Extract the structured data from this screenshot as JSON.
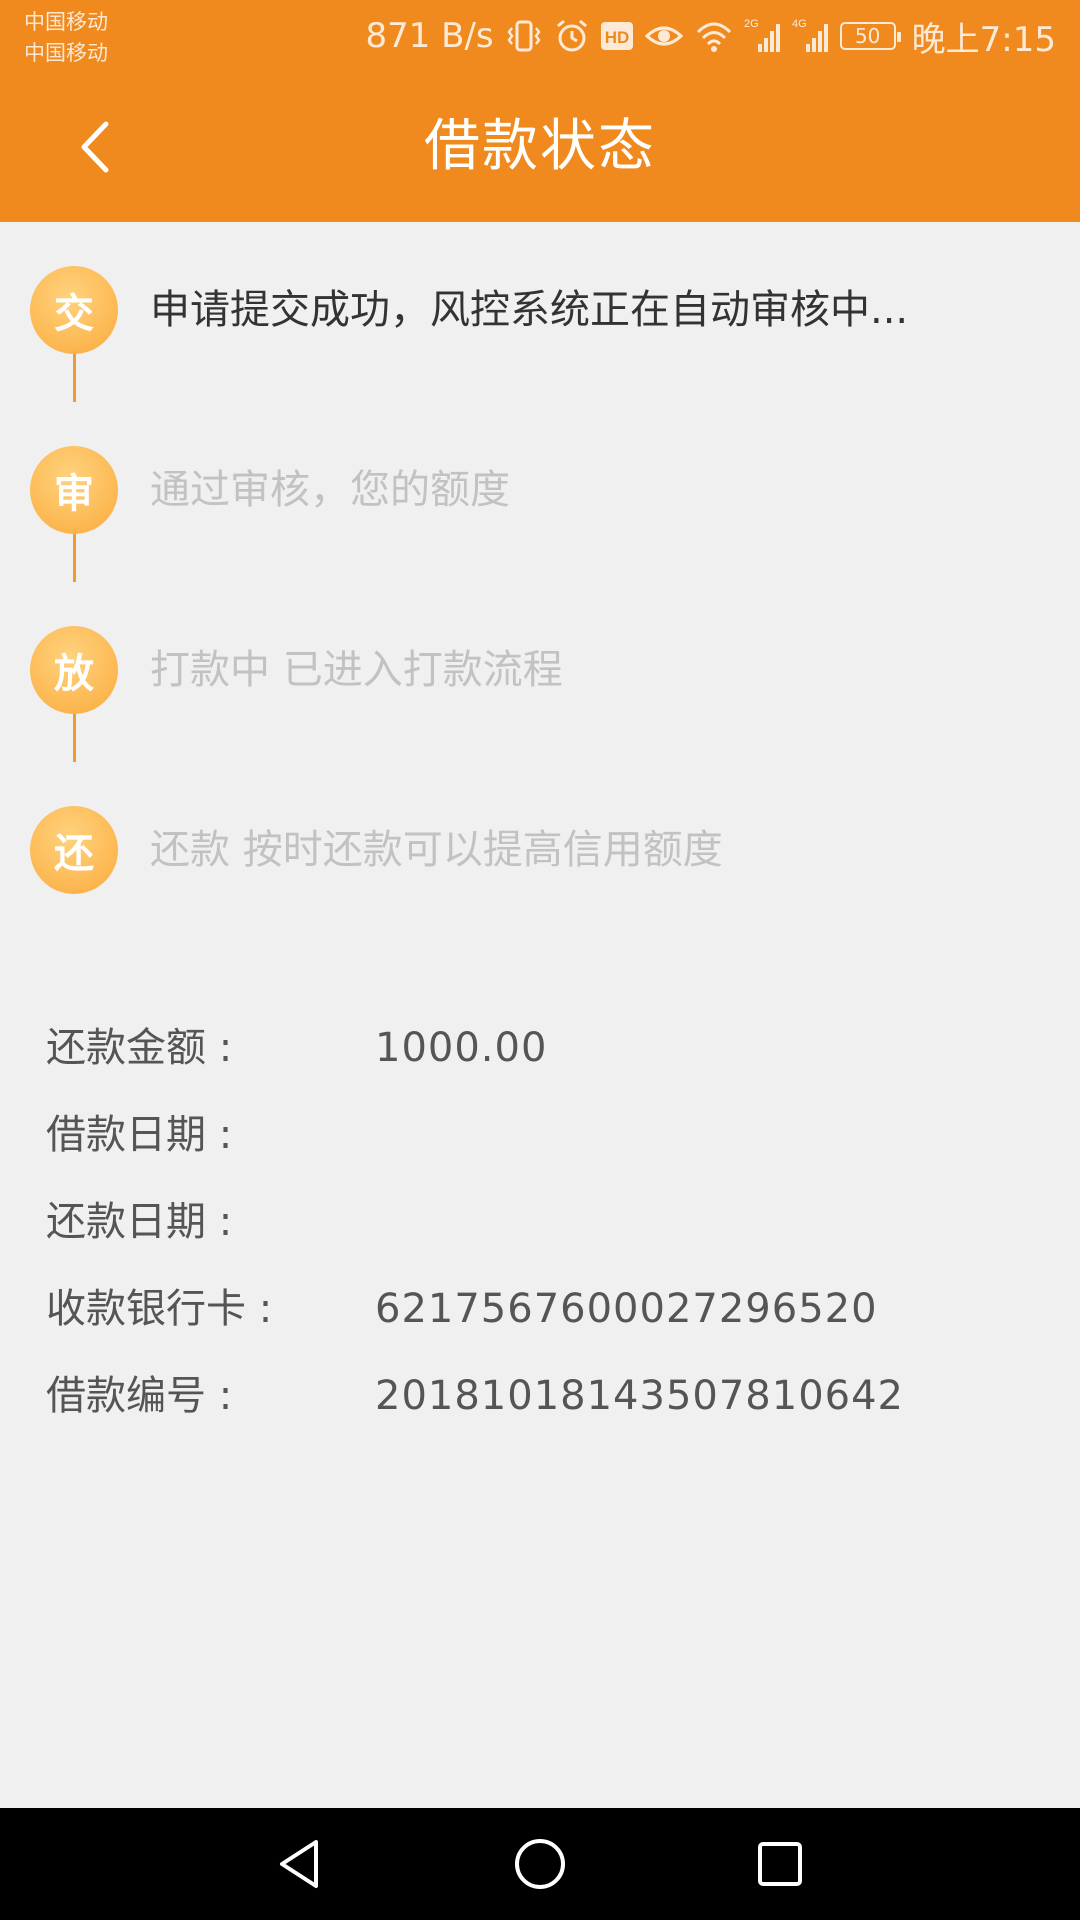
{
  "status_bar": {
    "carrier_1": "中国移动",
    "carrier_2": "中国移动",
    "net_speed": "871 B/s",
    "hd_badge": "HD",
    "battery_level": "50",
    "time": "晚上7:15",
    "signal_1_label": "2G",
    "signal_2_label": "4G",
    "icons": [
      "vibrate-icon",
      "alarm-icon",
      "hd-icon",
      "eye-icon",
      "wifi-icon",
      "signal-2g-icon",
      "signal-4g-icon",
      "battery-icon"
    ]
  },
  "header": {
    "title": "借款状态",
    "back_icon": "chevron-left-icon"
  },
  "timeline": {
    "steps": [
      {
        "badge": "交",
        "text": "申请提交成功，风控系统正在自动审核中...",
        "active": true
      },
      {
        "badge": "审",
        "text": "通过审核，您的额度",
        "active": false
      },
      {
        "badge": "放",
        "text": "打款中 已进入打款流程",
        "active": false
      },
      {
        "badge": "还",
        "text": "还款 按时还款可以提高信用额度",
        "active": false
      }
    ]
  },
  "details": {
    "rows": [
      {
        "label": "还款金额 :",
        "value": "1000.00"
      },
      {
        "label": "借款日期 :",
        "value": ""
      },
      {
        "label": "还款日期 :",
        "value": ""
      },
      {
        "label": "收款银行卡 :",
        "value": "6217567600027296520"
      },
      {
        "label": "借款编号 :",
        "value": "20181018143507810642"
      }
    ]
  },
  "nav_bar": {
    "icons": [
      "back-triangle-icon",
      "home-circle-icon",
      "recents-square-icon"
    ]
  },
  "colors": {
    "brand_orange": "#f08a1e",
    "badge_orange": "#fdbd5a",
    "background": "#f0f0f0",
    "text_active": "#333333",
    "text_inactive": "#c2c2c2",
    "text_detail": "#555555"
  }
}
